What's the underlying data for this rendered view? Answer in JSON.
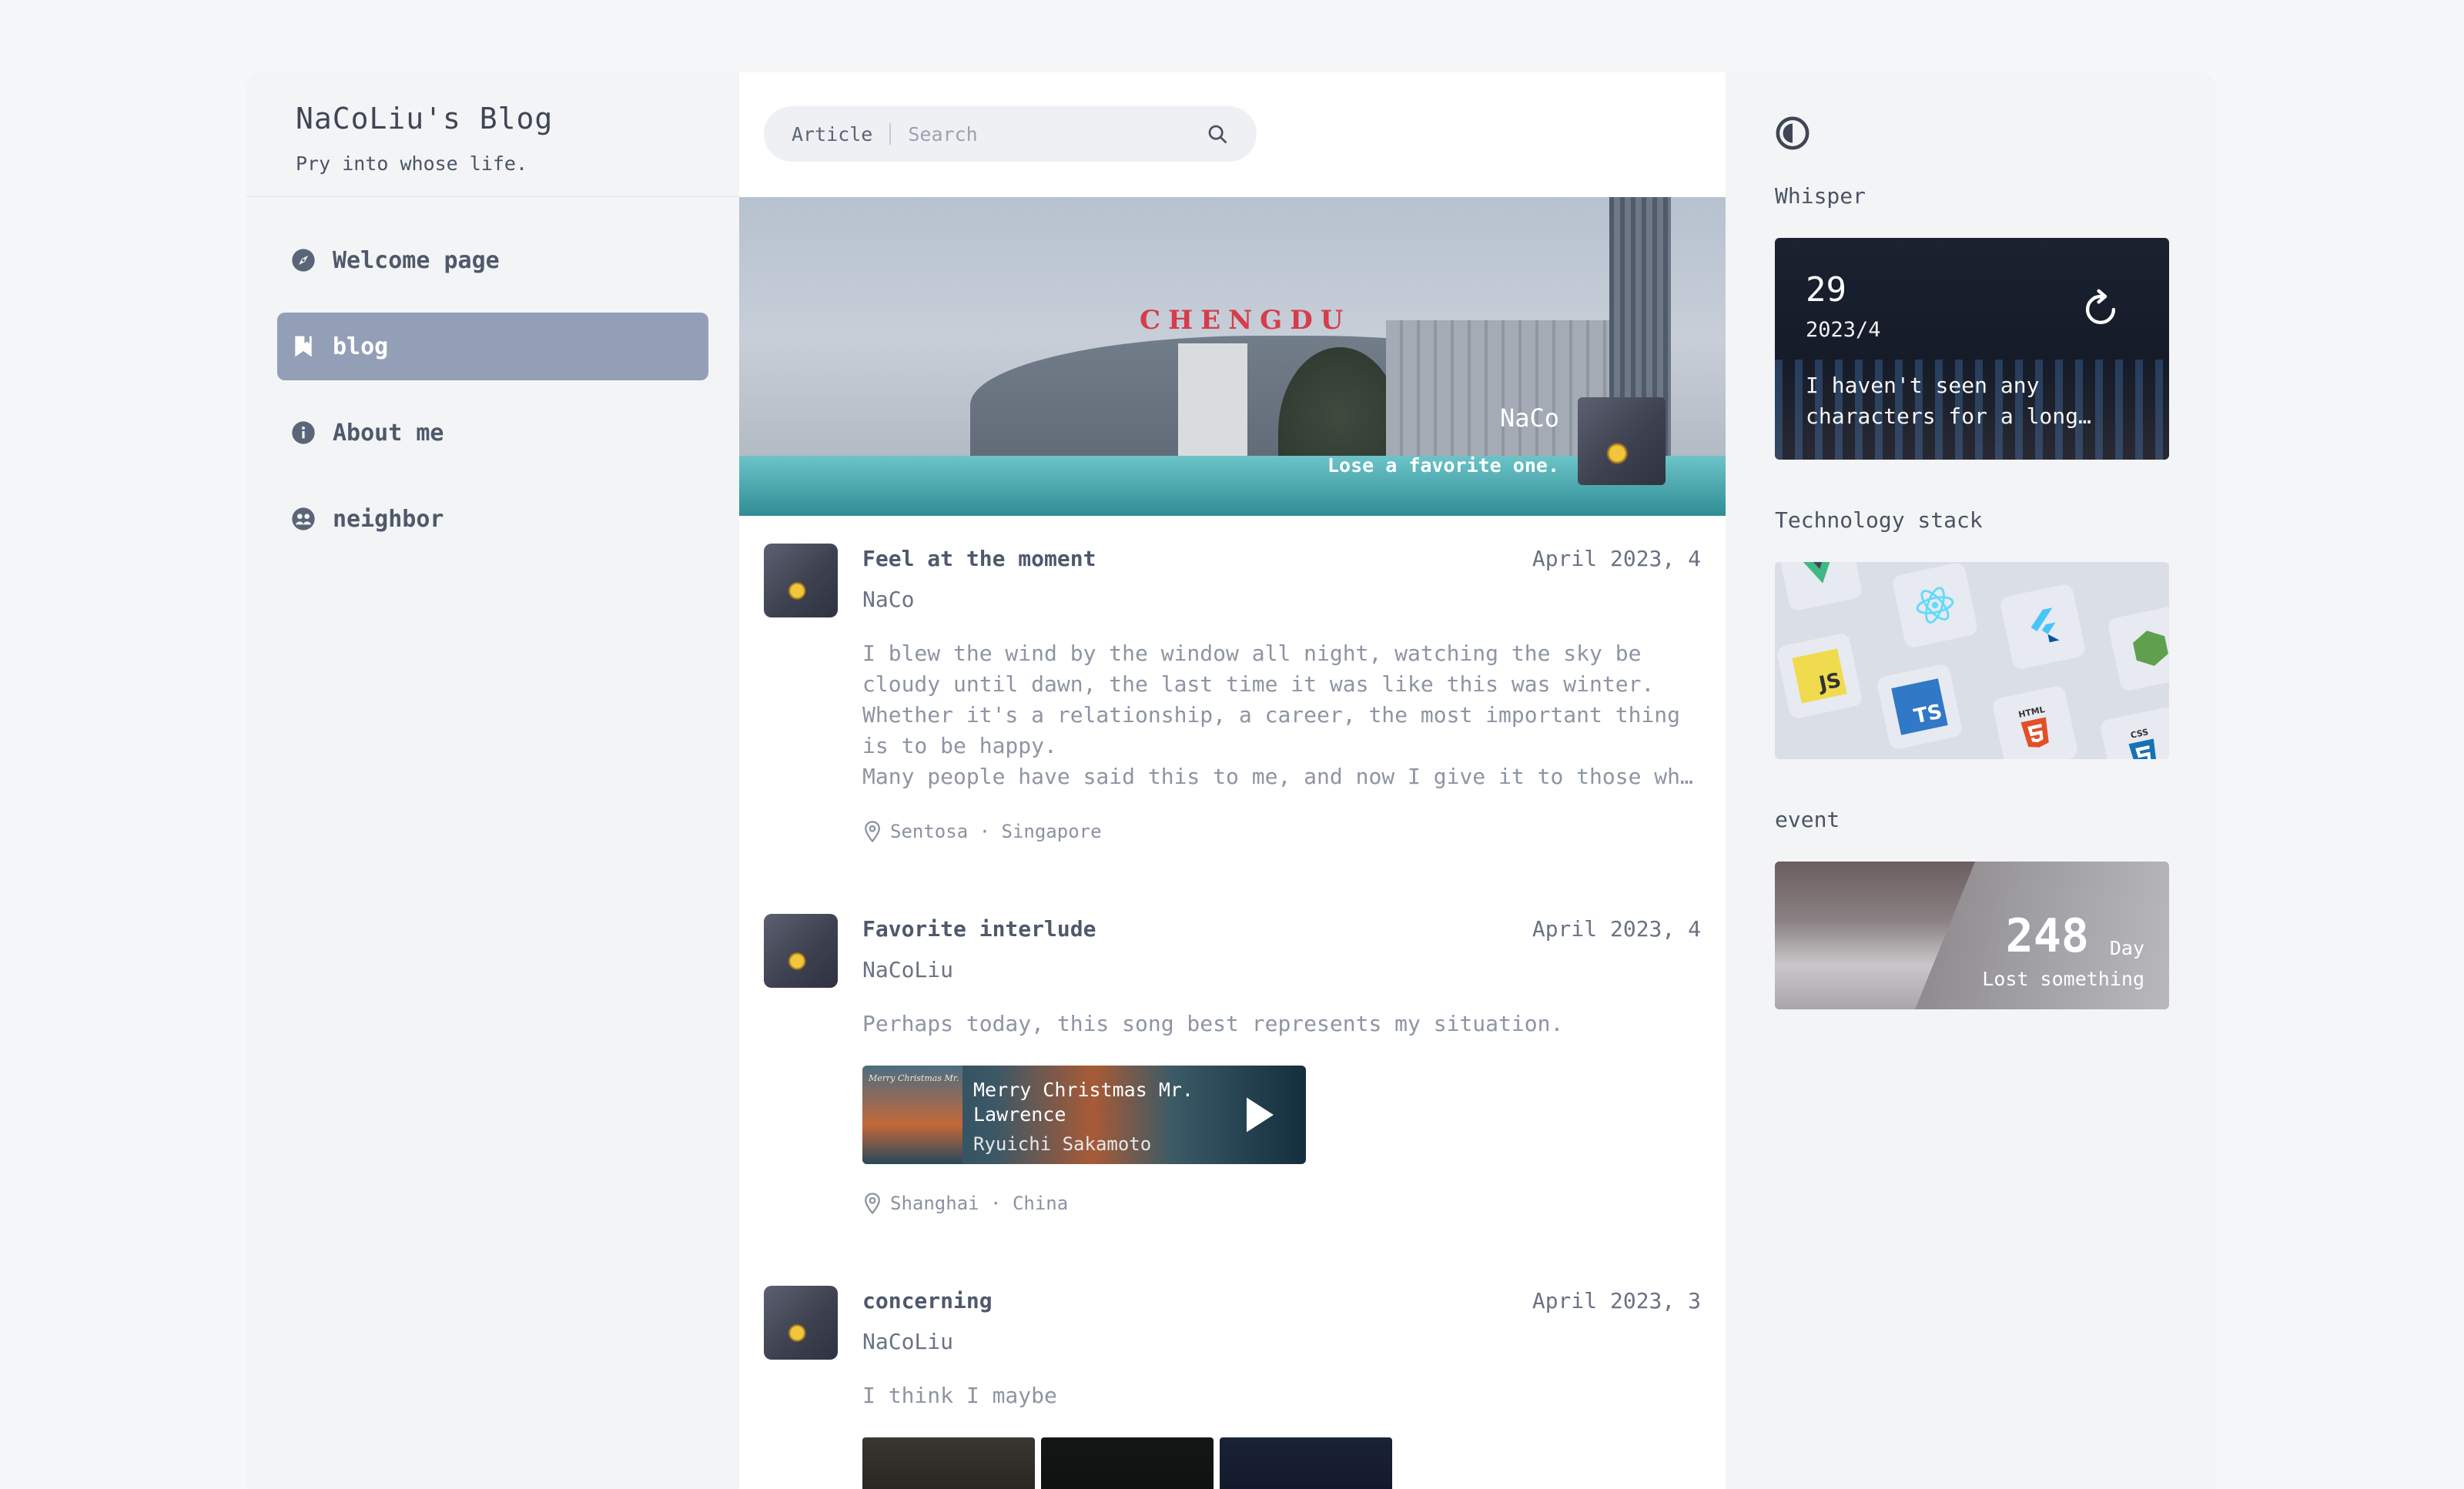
{
  "sidebar": {
    "title": "NaCoLiu's Blog",
    "subtitle": "Pry into whose life.",
    "nav": [
      {
        "label": "Welcome page",
        "icon": "compass-icon"
      },
      {
        "label": "blog",
        "icon": "bookmark-icon",
        "active": true
      },
      {
        "label": "About me",
        "icon": "info-icon"
      },
      {
        "label": "neighbor",
        "icon": "people-icon"
      }
    ]
  },
  "search": {
    "scope": "Article",
    "placeholder": "Search",
    "icon": "search-icon"
  },
  "cover": {
    "sign": "CHENGDU",
    "name": "NaCo",
    "motto": "Lose a favorite one."
  },
  "posts": [
    {
      "title": "Feel at the moment",
      "date": "April 2023, 4",
      "author": "NaCo",
      "body": "I blew the wind by the window all night, watching the sky be cloudy until dawn, the last time it was like this was winter. Whether it's a relationship, a career, the most important thing is to be happy.\nMany people have said this to me, and now I give it to those who are in love and the people around me.",
      "location": "Sentosa · Singapore"
    },
    {
      "title": "Favorite interlude",
      "date": "April 2023, 4",
      "author": "NaCoLiu",
      "body": "Perhaps today, this song best represents my situation.",
      "music": {
        "title": "Merry Christmas Mr. Lawrence",
        "artist": "Ryuichi Sakamoto",
        "cover_text": "Merry Christmas Mr. Lawrence"
      },
      "location": "Shanghai · China"
    },
    {
      "title": "concerning",
      "date": "April 2023, 3",
      "author": "NaCoLiu",
      "body": "I think I maybe"
    }
  ],
  "aside": {
    "theme_icon": "theme-toggle-icon",
    "whisper": {
      "label": "Whisper",
      "day": "29",
      "month": "2023/4",
      "text": "I haven't seen any characters for a long time."
    },
    "stack": {
      "label": "Technology stack",
      "tiles": [
        "JS",
        "TS",
        "HTML",
        "CSS"
      ]
    },
    "event": {
      "label": "event",
      "count": "248",
      "unit": "Day",
      "caption": "Lost something"
    }
  },
  "colors": {
    "accent": "#939fb6",
    "page_bg": "#f6f7f9",
    "panel_bg": "#f3f4f6",
    "text": "#4a5466"
  }
}
